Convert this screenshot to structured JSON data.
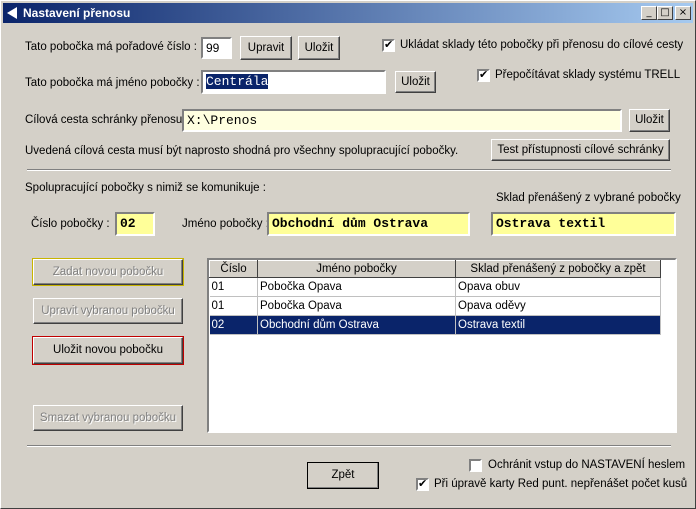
{
  "window": {
    "title": "Nastavení přenosu",
    "controls": {
      "minimize": "_",
      "maximize": "□",
      "close": "×"
    }
  },
  "branch_number": {
    "label": "Tato pobočka má pořadové číslo :",
    "value": "99",
    "edit_label": "Upravit",
    "save_label": "Uložit"
  },
  "branch_name": {
    "label": "Tato pobočka má jméno pobočky :",
    "value": "Centrála",
    "save_label": "Uložit"
  },
  "options": {
    "save_stores": {
      "label": "Ukládat sklady této pobočky při přenosu do cílové cesty",
      "checked": true
    },
    "recalc_trell": {
      "label": "Přepočítávat sklady systému TRELL",
      "checked": true
    }
  },
  "target_path": {
    "label": "Cílová cesta schránky přenosu",
    "value": "X:\\Prenos",
    "save_label": "Uložit",
    "note": "Uvedená cílová cesta musí být naprosto shodná pro všechny spolupracující pobočky.",
    "test_label": "Test přístupnosti cílové schránky"
  },
  "partners": {
    "heading": "Spolupracující pobočky s nimiž se komunikuje :",
    "store_heading": "Sklad přenášený z vybrané pobočky",
    "number_label": "Číslo pobočky :",
    "number_value": "02",
    "name_label": "Jméno pobočky :",
    "name_value": "Obchodní dům Ostrava",
    "store_value": "Ostrava textil"
  },
  "actions": {
    "add": "Zadat novou pobočku",
    "edit": "Upravit vybranou pobočku",
    "save": "Uložit novou pobočku",
    "delete": "Smazat vybranou pobočku"
  },
  "table": {
    "columns": [
      "Číslo",
      "Jméno pobočky",
      "Sklad přenášený z pobočky a zpět"
    ],
    "rows": [
      {
        "cells": [
          "01",
          "Pobočka Opava",
          "Opava obuv"
        ],
        "selected": false
      },
      {
        "cells": [
          "01",
          "Pobočka Opava",
          "Opava oděvy"
        ],
        "selected": false
      },
      {
        "cells": [
          "02",
          "Obchodní dům Ostrava",
          "Ostrava textil"
        ],
        "selected": true
      }
    ]
  },
  "footer": {
    "back_label": "Zpět",
    "protect": {
      "label": "Ochránit vstup do NASTAVENÍ heslem",
      "checked": false
    },
    "no_transfer": {
      "label": "Při úpravě karty Red punt. nepřenášet počet kusů",
      "checked": true
    }
  },
  "colors": {
    "title_bar": "#0a246a",
    "selection": "#0a246a",
    "input_highlight": "#ffff99",
    "face": "#d4d0c8"
  }
}
